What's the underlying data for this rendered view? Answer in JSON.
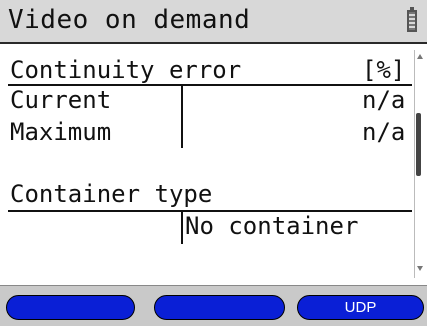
{
  "header": {
    "title": "Video on demand",
    "battery_icon": "battery-icon"
  },
  "sections": {
    "continuity": {
      "heading": "Continuity error",
      "unit": "[%]",
      "rows": [
        {
          "label": "Current",
          "value": "n/a"
        },
        {
          "label": "Maximum",
          "value": "n/a"
        }
      ]
    },
    "container": {
      "heading": "Container type",
      "value": "No container"
    }
  },
  "softkeys": [
    "",
    "",
    "UDP"
  ],
  "colors": {
    "softkey": "#0a1fd6",
    "titlebar": "#d8d8d8",
    "bottombar": "#c9c9c9"
  }
}
